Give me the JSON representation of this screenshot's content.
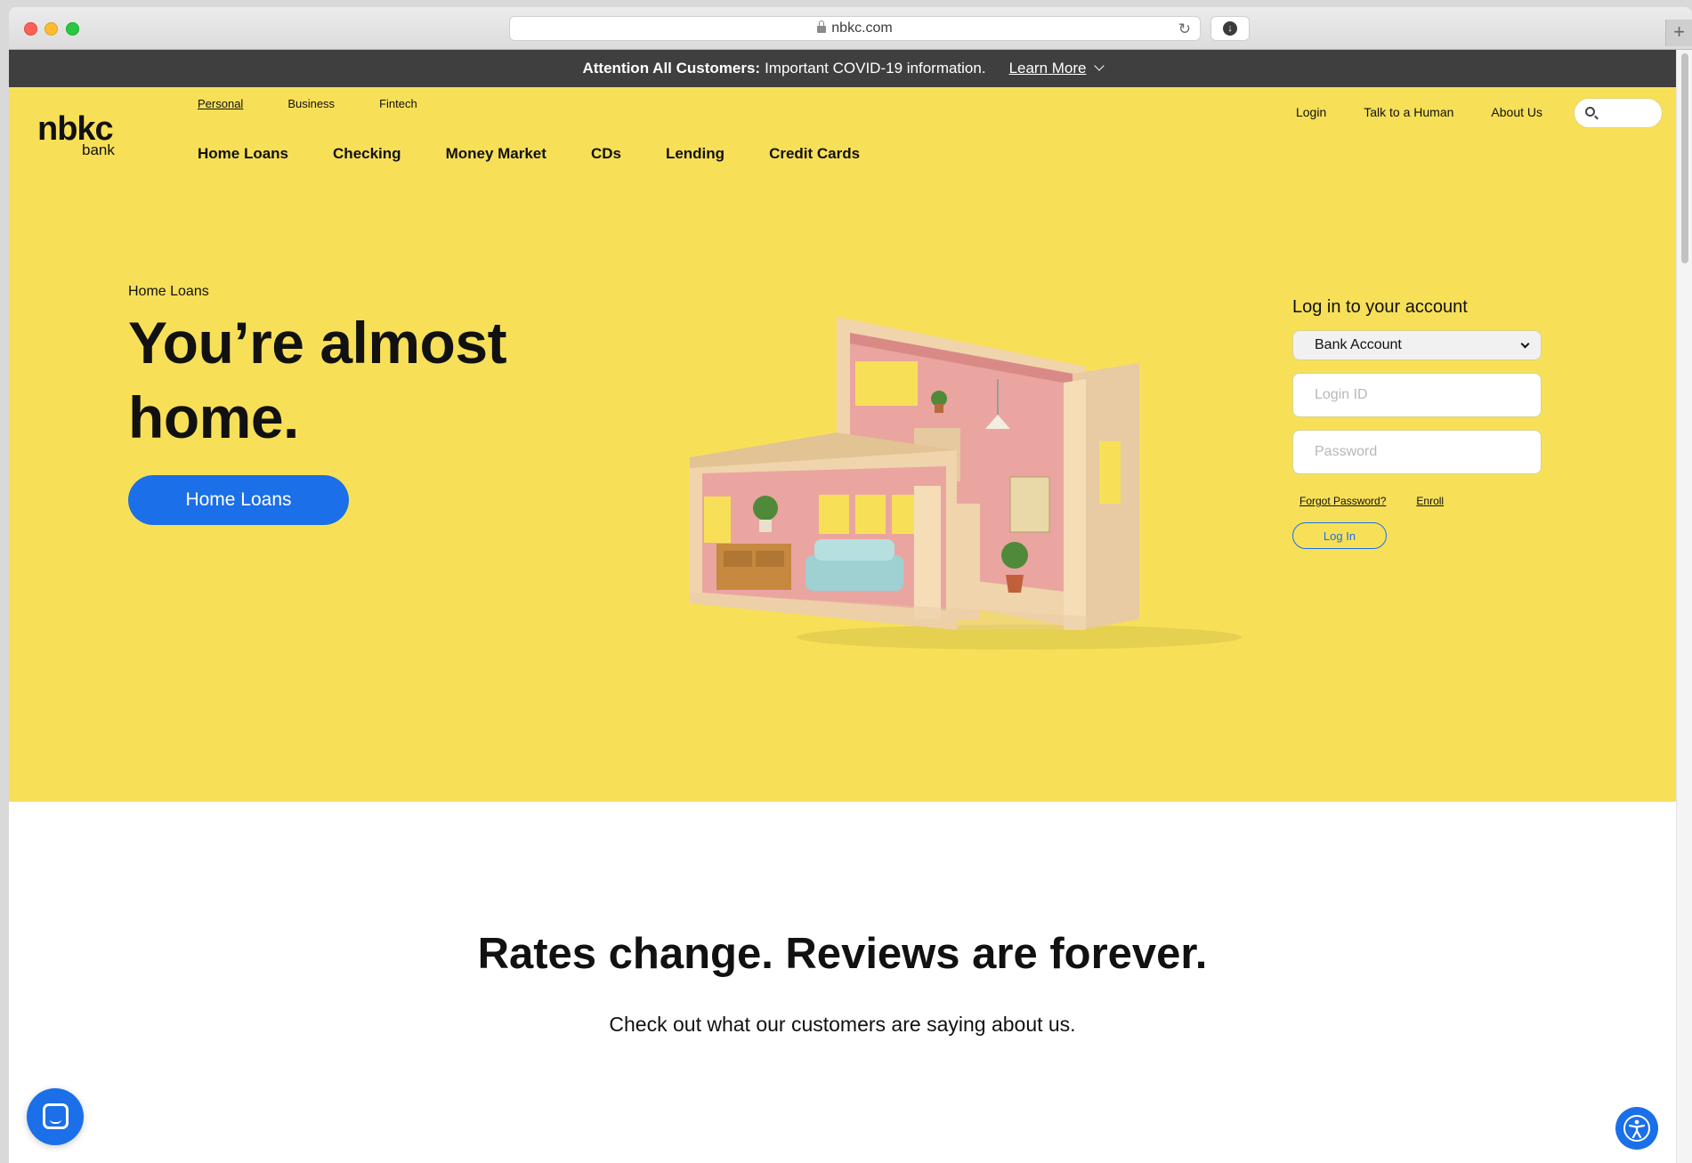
{
  "browser": {
    "url": "nbkc.com"
  },
  "announcement": {
    "bold": "Attention All Customers:",
    "text": "Important COVID-19 information.",
    "link": "Learn More"
  },
  "logo": {
    "main": "nbkc",
    "sub": "bank"
  },
  "segments": [
    "Personal",
    "Business",
    "Fintech"
  ],
  "main_nav": [
    "Home Loans",
    "Checking",
    "Money Market",
    "CDs",
    "Lending",
    "Credit Cards"
  ],
  "util_nav": [
    "Login",
    "Talk to a Human",
    "About Us"
  ],
  "hero": {
    "breadcrumb": "Home Loans",
    "headline": "You’re almost home.",
    "cta": "Home Loans"
  },
  "login": {
    "title": "Log in to your account",
    "account_type": "Bank Account",
    "login_placeholder": "Login ID",
    "password_placeholder": "Password",
    "forgot": "Forgot Password?",
    "enroll": "Enroll",
    "button": "Log In"
  },
  "reviews": {
    "title": "Rates change. Reviews are forever.",
    "subtitle": "Check out what our customers are saying about us."
  },
  "colors": {
    "hero_bg": "#f7e058",
    "accent": "#1b6fe8",
    "dark_bar": "#3f3f3f"
  }
}
